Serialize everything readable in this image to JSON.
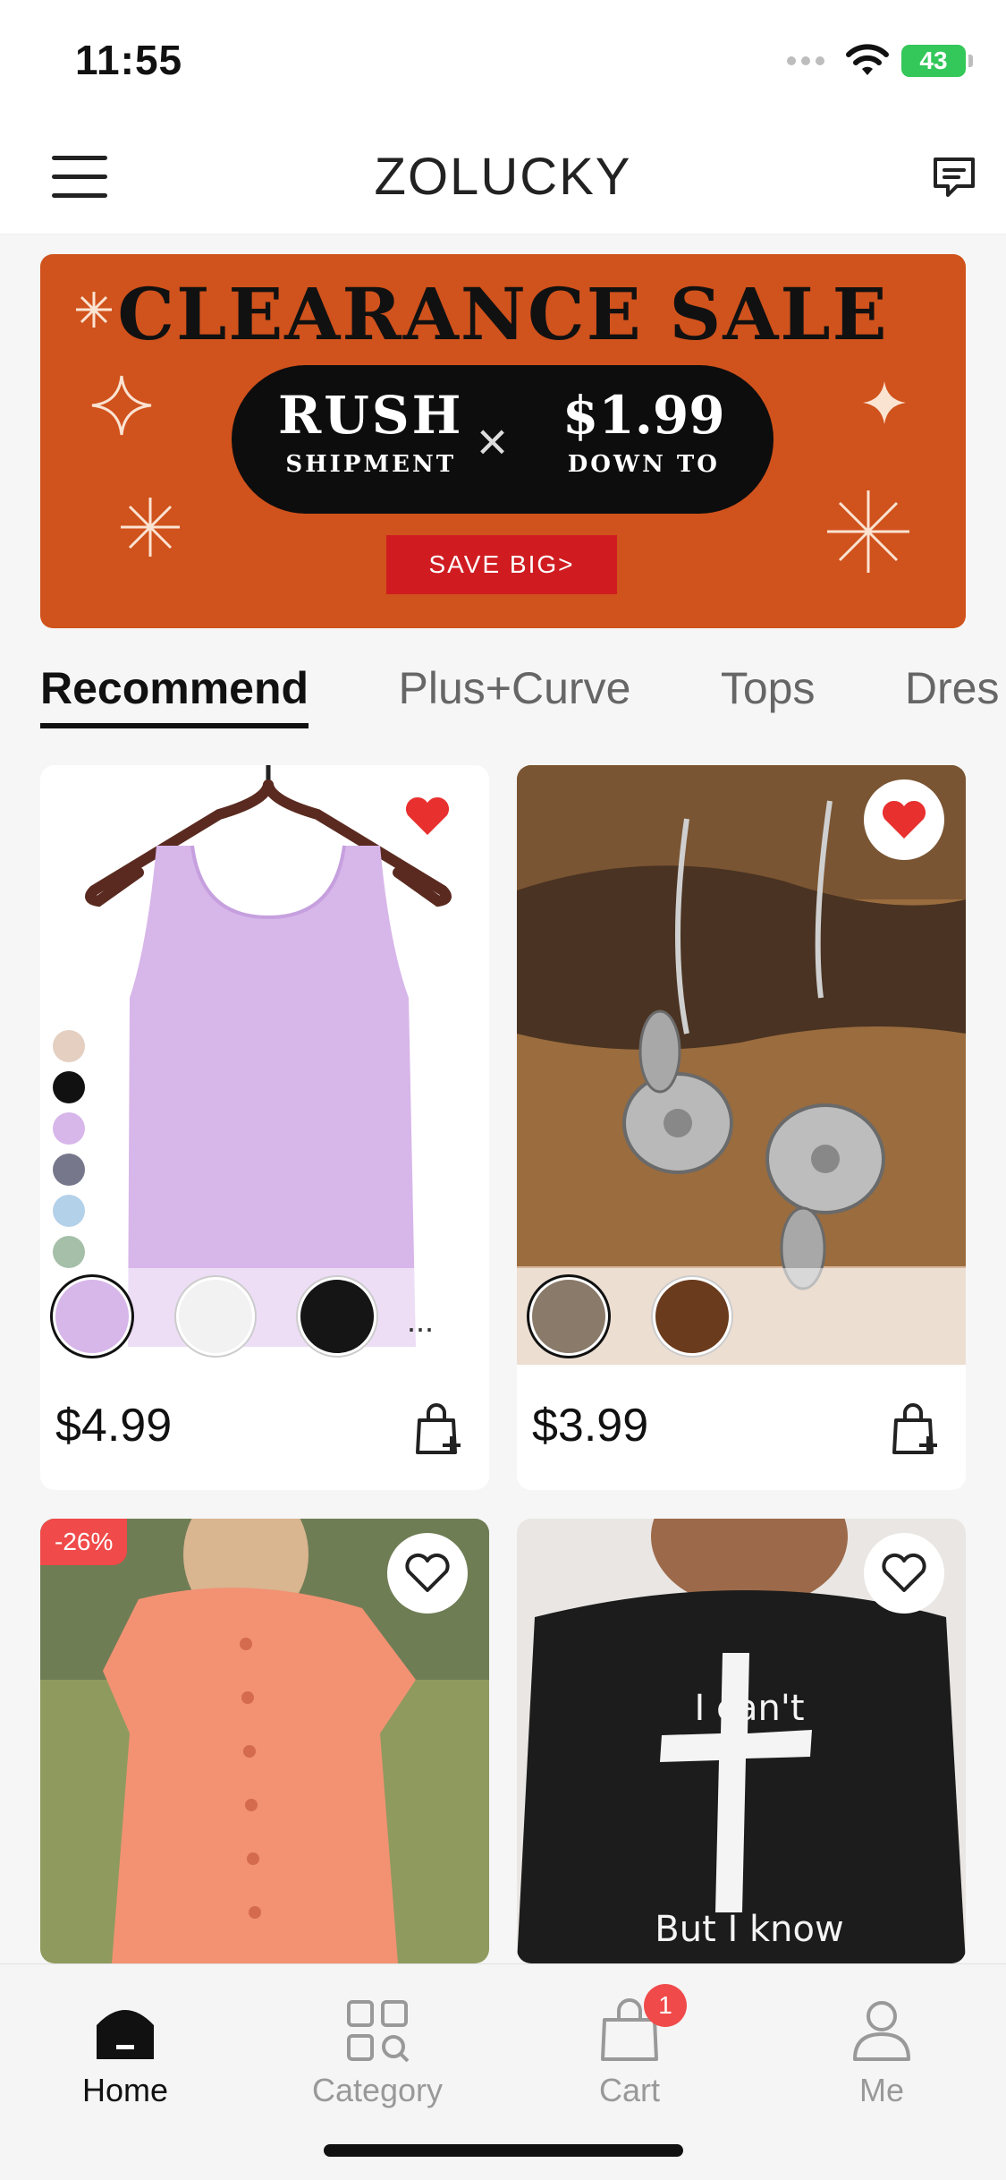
{
  "status_bar": {
    "time": "11:55",
    "battery": "43"
  },
  "header": {
    "brand": "ZOLUCKY"
  },
  "banner": {
    "title": "CLEARANCE SALE",
    "left_big": "RUSH",
    "left_small": "SHIPMENT",
    "separator": "×",
    "right_big": "$1.99",
    "right_small": "DOWN TO",
    "cta": "SAVE BIG>",
    "colors": {
      "background": "#d0521c",
      "cta": "#d01c21"
    }
  },
  "tabs": [
    {
      "label": "Recommend",
      "active": true
    },
    {
      "label": "Plus+Curve",
      "active": false
    },
    {
      "label": "Tops",
      "active": false
    },
    {
      "label": "Dres",
      "active": false
    }
  ],
  "products": [
    {
      "name": "lilac tank top",
      "price": "$4.99",
      "favorited": true,
      "swatches": [
        "lilac",
        "white",
        "black"
      ],
      "more": "..."
    },
    {
      "name": "silver flower earrings",
      "price": "$3.99",
      "favorited": true,
      "swatches": [
        "silver",
        "bronze"
      ]
    },
    {
      "name": "coral button dress",
      "discount": "-26%",
      "favorited": false
    },
    {
      "name": "black cross sweatshirt",
      "print_top": "I can't",
      "print_bottom": "But I know",
      "favorited": false
    }
  ],
  "tabbar": {
    "items": [
      {
        "label": "Home",
        "icon": "home-icon",
        "active": true
      },
      {
        "label": "Category",
        "icon": "category-icon",
        "active": false
      },
      {
        "label": "Cart",
        "icon": "cart-icon",
        "active": false
      },
      {
        "label": "Me",
        "icon": "profile-icon",
        "active": false
      }
    ],
    "cart_badge": "1"
  },
  "colors": {
    "accent_red": "#f04a4a",
    "heart": "#e8302f"
  }
}
